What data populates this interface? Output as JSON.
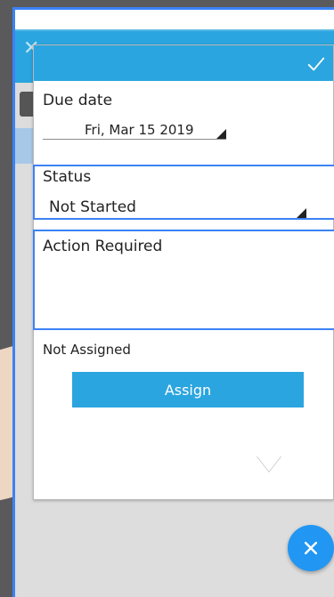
{
  "dialog": {
    "due_date_label": "Due date",
    "due_date_value": "Fri, Mar 15 2019",
    "status_label": "Status",
    "status_value": "Not Started",
    "action_required_label": "Action Required",
    "action_required_value": "",
    "assignee_text": "Not Assigned",
    "assign_button_label": "Assign"
  },
  "icons": {
    "confirm": "check-icon",
    "close": "close-icon",
    "dropdown": "triangle-dropdown-icon"
  },
  "colors": {
    "accent": "#2BA5DF",
    "fab": "#2196F3",
    "focus_border": "#3B82F6"
  }
}
